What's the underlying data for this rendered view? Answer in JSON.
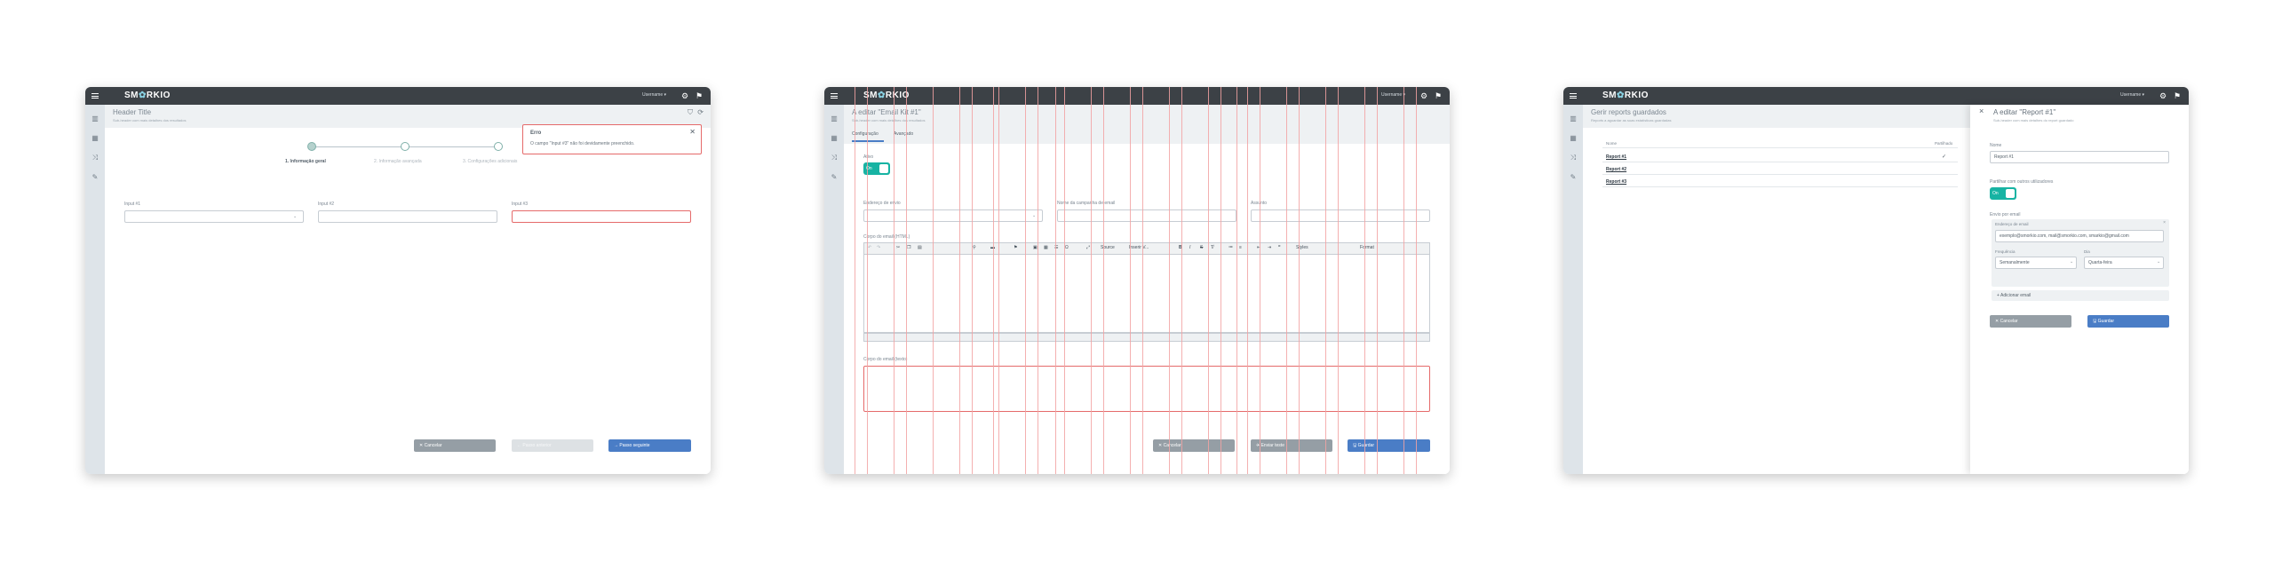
{
  "app": {
    "logo_prefix": "SM",
    "logo_o": "✿",
    "logo_suffix": "RKIO",
    "username": "Username ▾"
  },
  "screen1": {
    "title": "Header Title",
    "subtitle": "Sub-header com mais detalhes dos resultados",
    "steps": [
      {
        "label": "1. Informação geral",
        "active": true
      },
      {
        "label": "2. Informação avançada",
        "active": false
      },
      {
        "label": "3. Configurações adicionais",
        "active": false
      }
    ],
    "toast": {
      "title": "Erro",
      "message": "O campo \"Input #3\" não foi devidamente preenchido."
    },
    "inputs": [
      {
        "label": "Input #1",
        "value": ""
      },
      {
        "label": "Input #2",
        "value": ""
      },
      {
        "label": "Input #3",
        "value": ""
      }
    ],
    "buttons": {
      "cancel": "✕  Cancelar",
      "previous": "←  Passo anterior",
      "next": "→  Passo seguinte"
    }
  },
  "screen2": {
    "title": "A editar \"Email Kit #1\"",
    "subtitle": "Sub-header com mais detalhes dos resultados",
    "tabs": [
      "Configuração",
      "Avançado"
    ],
    "active_label": "Ativo",
    "toggle_on": "On",
    "fields": [
      {
        "label": "Endereço de envio",
        "value": ""
      },
      {
        "label": "Nome da campanha de email",
        "value": ""
      },
      {
        "label": "Assunto",
        "value": ""
      }
    ],
    "html_body_label": "Corpo do email (HTML)",
    "text_body_label": "Corpo do email (texto)",
    "editor": {
      "source": "Source",
      "insert": "Inserir V...",
      "styles": "Styles",
      "format": "Format"
    },
    "buttons": {
      "cancel": "✕  Cancelar",
      "test": "✈  Enviar teste",
      "save": "🖫  Guardar"
    }
  },
  "screen3": {
    "title": "Gerir reports guardados",
    "subtitle": "Reports a aguardar as suas estatísticas guardadas",
    "columns": {
      "name": "Nome",
      "shared": "Partilhado"
    },
    "rows": [
      {
        "name": "Report #1",
        "shared": "✓"
      },
      {
        "name": "Report #2",
        "shared": ""
      },
      {
        "name": "Report #3",
        "shared": ""
      }
    ],
    "panel": {
      "title": "A editar \"Report #1\"",
      "subtitle": "Sub-header com mais detalhes do report guardado",
      "name_label": "Nome",
      "name_value": "Report #1",
      "share_label": "Partilhar com outros utilizadores",
      "toggle_on": "On",
      "email_section": "Envio por email",
      "email_label": "Endereço de email",
      "email_value": "exemplo@smorkio.com, mail@smorkio.com, smarkio@gmail.com",
      "frequency_label": "Frequência",
      "frequency_value": "Semanalmente",
      "day_label": "Dia",
      "day_value": "Quarta-feira",
      "add_email": "+  Adicionar email",
      "cancel": "✕  Cancelar",
      "save": "🖫  Guardar"
    }
  }
}
